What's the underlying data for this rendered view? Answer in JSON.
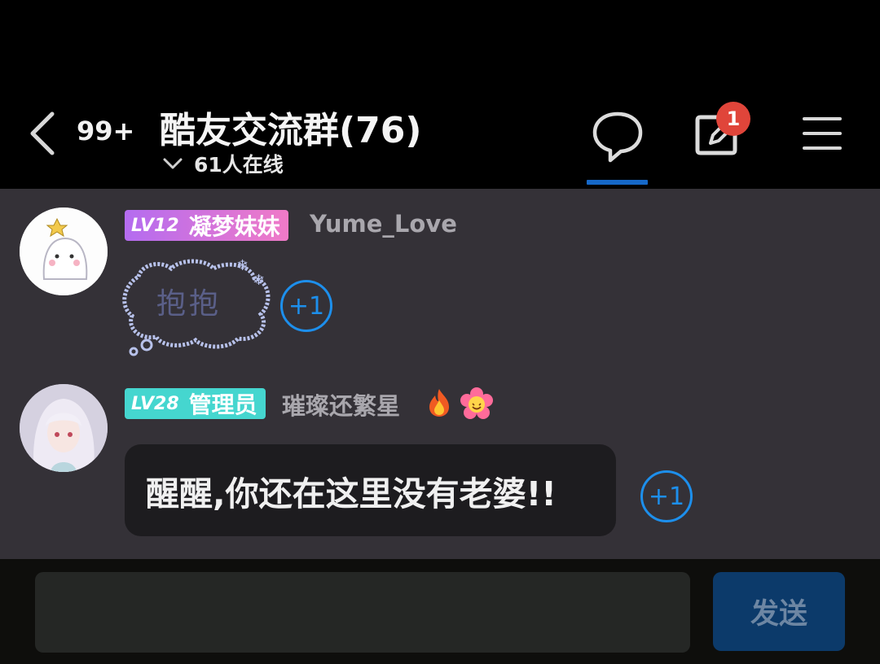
{
  "header": {
    "unread_count": "99+",
    "title": "酷友交流群(76)",
    "online": "61人在线",
    "notification_badge": "1"
  },
  "messages": [
    {
      "level_prefix": "LV",
      "level_num": "12",
      "rank": "凝梦妹妹",
      "username": "Yume_Love",
      "sticker_text": "抱抱",
      "plus_one": "+1"
    },
    {
      "level_prefix": "LV",
      "level_num": "28",
      "rank": "管理员",
      "username": "璀璨还繁星",
      "text": "醒醒,你还在这里没有老婆!!",
      "plus_one": "+1"
    }
  ],
  "composer": {
    "input_value": "",
    "send_label": "发送"
  },
  "colors": {
    "accent": "#1d8fec",
    "tab_underline": "#1668c8",
    "badge": "#e0453a",
    "chat_bg": "#343137",
    "admin_tag": "#45d6cf"
  },
  "icons": [
    "back-chevron-icon",
    "chevron-down-icon",
    "chat-bubble-icon",
    "edit-post-icon",
    "menu-icon",
    "fire-emoji-icon",
    "flower-emoji-icon"
  ]
}
